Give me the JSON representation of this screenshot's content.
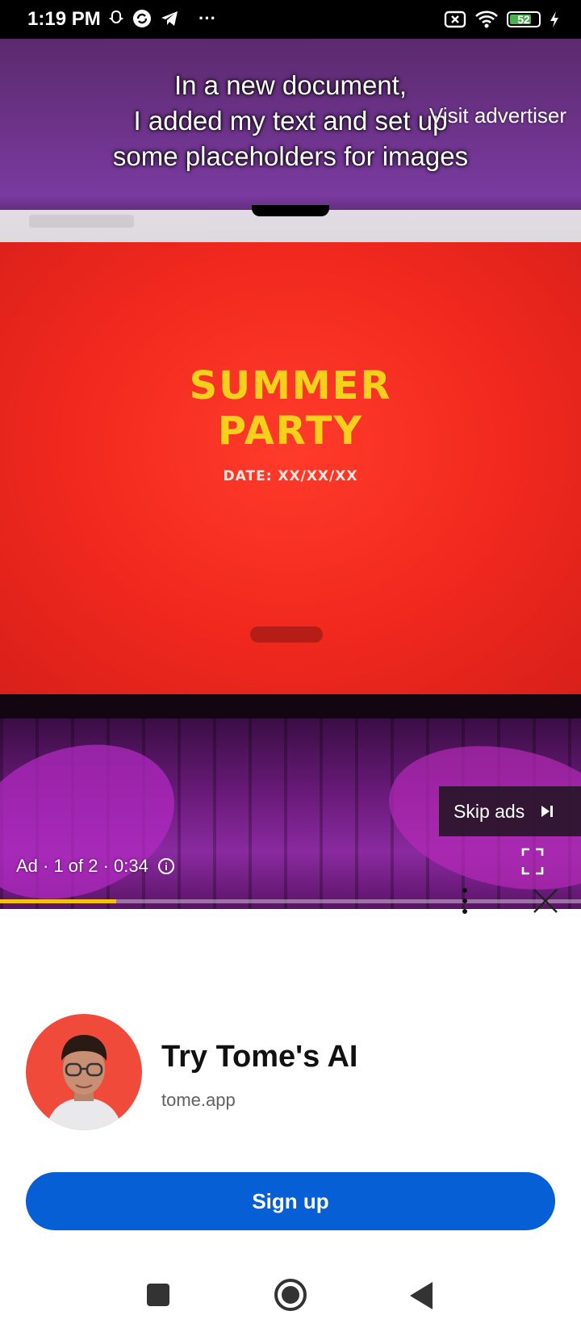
{
  "status_bar": {
    "time": "1:19 PM",
    "battery": "52",
    "icons_left": [
      "snapchat-icon",
      "sync-icon",
      "telegram-icon",
      "more-icon"
    ],
    "icons_right": [
      "screen-record-icon",
      "wifi-icon",
      "battery-icon",
      "charging-icon"
    ],
    "more_label": "···"
  },
  "video": {
    "caption_lines": [
      "In a new document,",
      "I added my text and set up",
      "some placeholders for images"
    ],
    "visit_advertiser": "Visit advertiser",
    "screen_title_lines": [
      "SUMMER",
      "PARTY"
    ],
    "screen_date": "DATE: XX/XX/XX",
    "skip_label": "Skip ads",
    "ad_info": "Ad · 1 of 2 · 0:34",
    "progress": 0.2,
    "colors": {
      "progress": "#f4c20d"
    }
  },
  "ad_panel": {
    "title": "Try Tome's AI",
    "domain": "tome.app",
    "cta": "Sign up",
    "colors": {
      "cta": "#065fd4",
      "avatar_bg": "#ef4a3a"
    }
  },
  "nav_bar": {
    "buttons": [
      "recents-button",
      "home-button",
      "back-button"
    ]
  }
}
